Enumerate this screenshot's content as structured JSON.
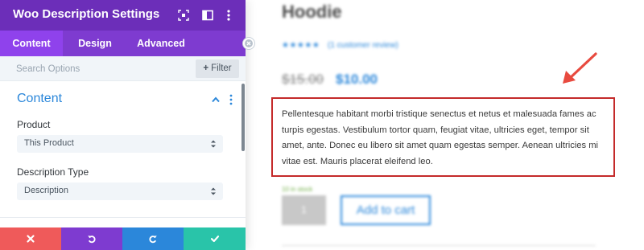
{
  "panel": {
    "title": "Woo Description Settings",
    "tabs": [
      {
        "label": "Content",
        "active": true
      },
      {
        "label": "Design",
        "active": false
      },
      {
        "label": "Advanced",
        "active": false
      }
    ],
    "search": {
      "placeholder": "Search Options"
    },
    "filter": {
      "label": "Filter"
    },
    "section": {
      "title": "Content"
    },
    "fields": [
      {
        "label": "Product",
        "value": "This Product"
      },
      {
        "label": "Description Type",
        "value": "Description"
      }
    ],
    "footer_buttons": [
      {
        "action": "discard",
        "icon": "close-icon",
        "color": "#ef5a5a"
      },
      {
        "action": "undo",
        "icon": "undo-icon",
        "color": "#7e3bd0"
      },
      {
        "action": "redo",
        "icon": "redo-icon",
        "color": "#2b87da"
      },
      {
        "action": "save",
        "icon": "check-icon",
        "color": "#29c4a9"
      }
    ]
  },
  "product": {
    "title": "Hoodie",
    "rating_stars": "★★★★★",
    "reviews": "(1 customer review)",
    "old_price": "$15.00",
    "new_price": "$10.00",
    "description": "Pellentesque habitant morbi tristique senectus et netus et malesuada fames ac turpis egestas. Vestibulum tortor quam, feugiat vitae, ultricies eget, tempor sit amet, ante. Donec eu libero sit amet quam egestas semper. Aenean ultricies mi vitae est. Mauris placerat eleifend leo.",
    "stock": "10 in stock",
    "quantity": "1",
    "add_to_cart": "Add to cart"
  },
  "colors": {
    "header": "#6c2eb9",
    "tabs": "#7e3bd0",
    "accent": "#2b87da",
    "highlight_border": "#c42a2a",
    "arrow": "#e84a3f"
  }
}
